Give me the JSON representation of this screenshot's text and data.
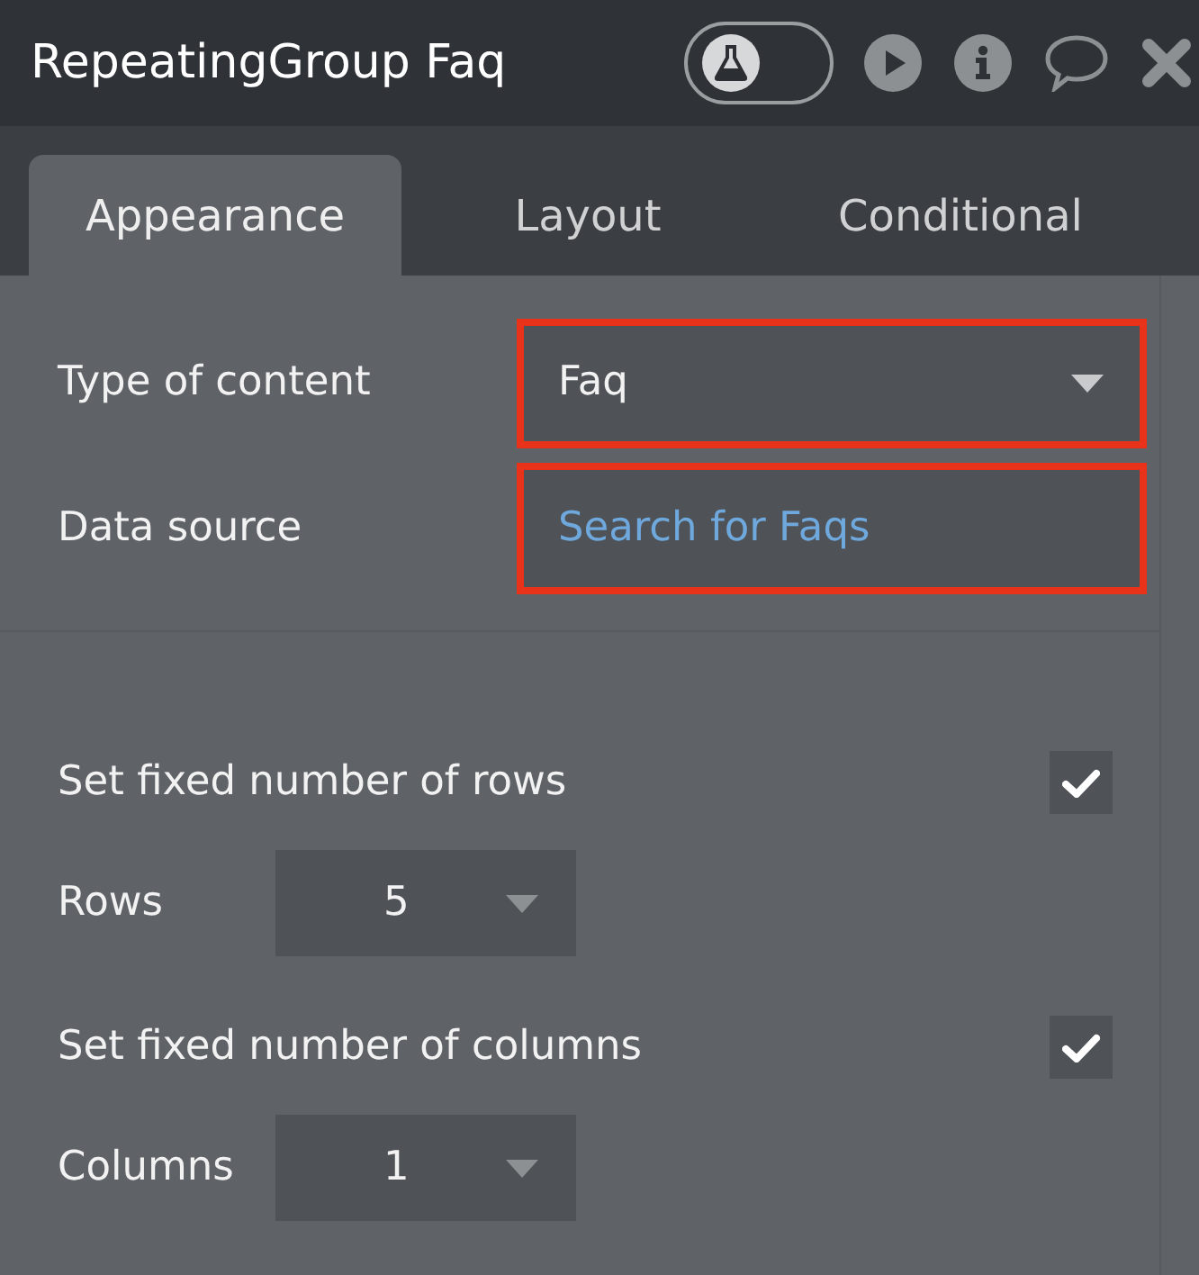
{
  "header": {
    "title": "RepeatingGroup Faq",
    "toggle": {
      "on": false
    }
  },
  "tabs": [
    {
      "label": "Appearance",
      "selected": true
    },
    {
      "label": "Layout",
      "selected": false
    },
    {
      "label": "Conditional",
      "selected": false
    }
  ],
  "fields": [
    {
      "label": "Type of content",
      "kind": "dropdown",
      "value": "Faq",
      "highlighted": true
    },
    {
      "label": "Data source",
      "kind": "expression",
      "value": "Search for Faqs",
      "highlighted": true
    }
  ],
  "settings": [
    {
      "kind": "checkbox",
      "label": "Set fixed number of rows",
      "checked": true
    },
    {
      "kind": "number",
      "label": "Rows",
      "value": "5"
    },
    {
      "kind": "checkbox",
      "label": "Set fixed number of columns",
      "checked": true
    },
    {
      "kind": "number",
      "label": "Columns",
      "value": "1"
    }
  ]
}
